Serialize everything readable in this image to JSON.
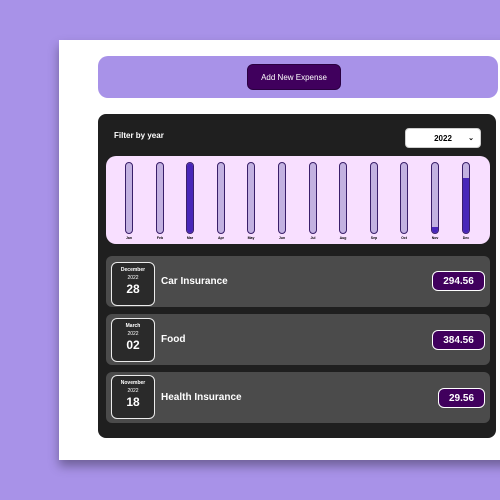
{
  "new_expense": {
    "button_label": "Add New Expense"
  },
  "filter": {
    "label": "Filter by year",
    "selected_year": "2022"
  },
  "chart_data": {
    "type": "bar",
    "categories": [
      "Jan",
      "Feb",
      "Mar",
      "Apr",
      "May",
      "Jun",
      "Jul",
      "Aug",
      "Sep",
      "Oct",
      "Nov",
      "Dec"
    ],
    "values": [
      0,
      0,
      384.56,
      0,
      0,
      0,
      0,
      0,
      0,
      0,
      29.56,
      294.56
    ],
    "ylim": [
      0,
      384.56
    ]
  },
  "expenses": [
    {
      "month": "December",
      "year": "2022",
      "day": "28",
      "title": "Car Insurance",
      "amount": "294.56"
    },
    {
      "month": "March",
      "year": "2022",
      "day": "02",
      "title": "Food",
      "amount": "384.56"
    },
    {
      "month": "November",
      "year": "2022",
      "day": "18",
      "title": "Health Insurance",
      "amount": "29.56"
    }
  ],
  "colors": {
    "accent": "#40005d",
    "background": "#a892e8",
    "bar_fill": "#4826b9"
  }
}
